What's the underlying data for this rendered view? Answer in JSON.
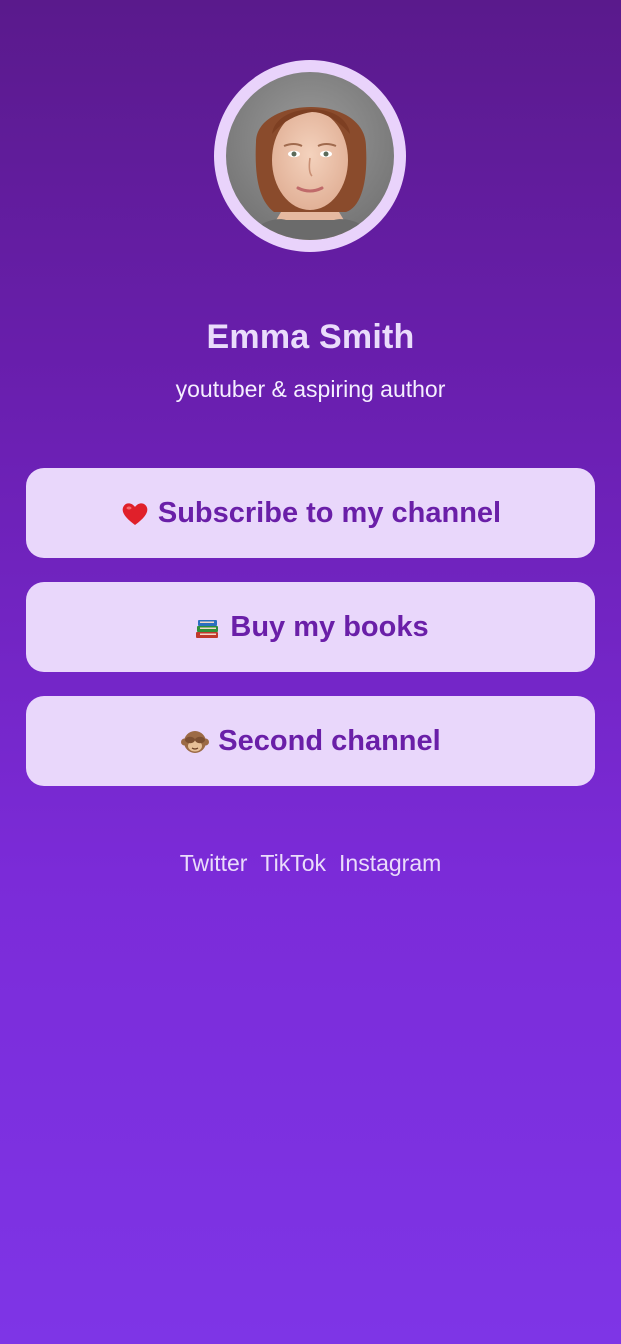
{
  "profile": {
    "name": "Emma Smith",
    "bio": "youtuber & aspiring author",
    "avatar_icon": "profile-photo"
  },
  "links": [
    {
      "emoji": "heart-icon",
      "label": "Subscribe to my channel"
    },
    {
      "emoji": "books-icon",
      "label": "Buy my books"
    },
    {
      "emoji": "monkey-icon",
      "label": "Second channel"
    }
  ],
  "social": [
    {
      "label": "Twitter"
    },
    {
      "label": "TikTok"
    },
    {
      "label": "Instagram"
    }
  ],
  "colors": {
    "button_bg": "#e9d7fb",
    "button_text": "#6a1fa8",
    "background_top": "#5a1a8c",
    "background_bottom": "#7e35e6"
  }
}
